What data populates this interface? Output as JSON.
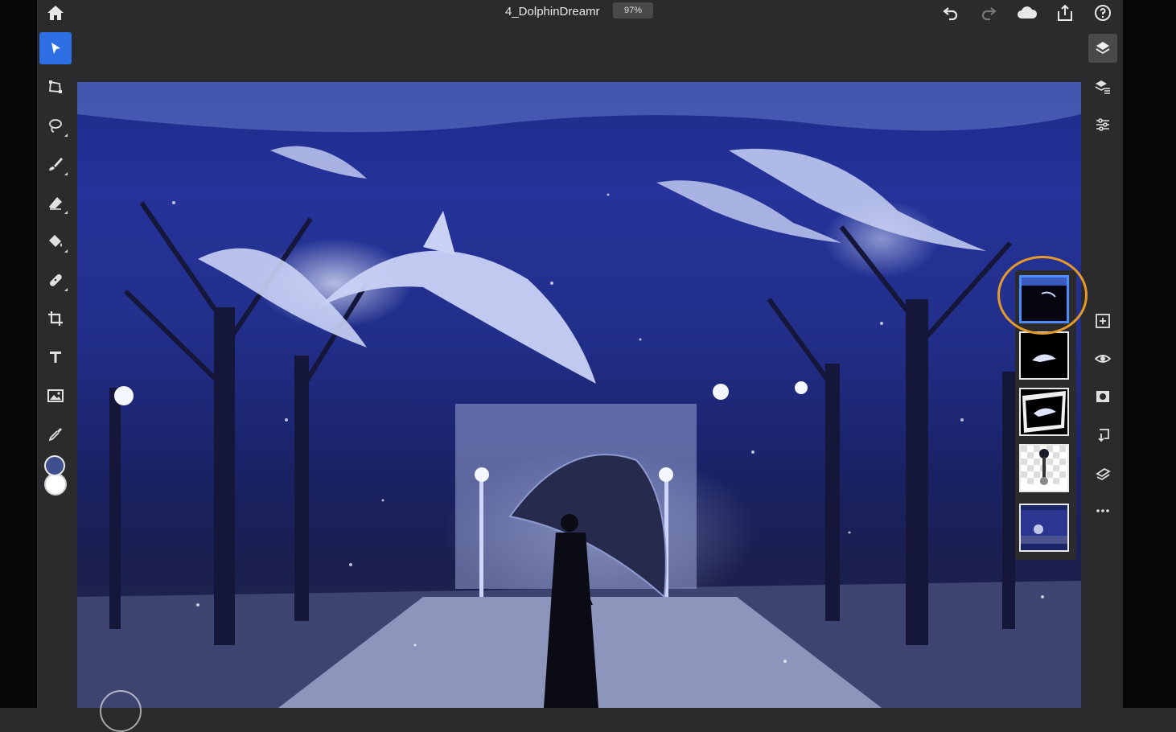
{
  "document": {
    "title": "4_DolphinDreamr",
    "zoom": "97%"
  },
  "topbar": {
    "icons": [
      "home-icon",
      "undo-icon",
      "redo-icon",
      "cloud-icon",
      "share-icon",
      "help-icon"
    ]
  },
  "left_toolbar": {
    "tools": [
      {
        "name": "select-tool",
        "icon": "arrow-pointer-icon",
        "active": true
      },
      {
        "name": "transform-tool",
        "icon": "transform-icon"
      },
      {
        "name": "lasso-tool",
        "icon": "lasso-icon"
      },
      {
        "name": "brush-tool",
        "icon": "brush-icon"
      },
      {
        "name": "eraser-tool",
        "icon": "eraser-icon"
      },
      {
        "name": "fill-tool",
        "icon": "paint-bucket-icon"
      },
      {
        "name": "healing-tool",
        "icon": "bandage-icon"
      },
      {
        "name": "crop-tool",
        "icon": "crop-icon"
      },
      {
        "name": "type-tool",
        "icon": "type-icon"
      },
      {
        "name": "place-image-tool",
        "icon": "image-icon"
      },
      {
        "name": "eyedropper-tool",
        "icon": "eyedropper-icon"
      }
    ],
    "foreground_color": "#3d4f8c",
    "background_color": "#ffffff"
  },
  "right_panel": {
    "icons": [
      "layers-icon",
      "layer-properties-icon",
      "adjustments-icon",
      "add-layer-icon",
      "visibility-icon",
      "mask-icon",
      "merge-layer-icon",
      "clipping-icon",
      "more-icon"
    ],
    "layer_count": 5,
    "selected_layer_index": 0
  },
  "accent": {
    "selection": "#2f6fe4",
    "highlight_ring": "#e59b2a"
  }
}
